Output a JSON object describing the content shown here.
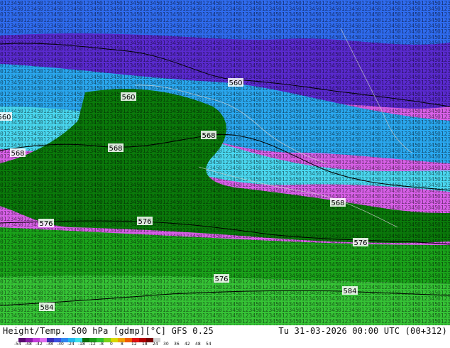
{
  "title": {
    "product": "Height/Temp. 500 hPa [gdmp][°C] GFS 0.25",
    "valid": "Tu 31-03-2026 00:00 UTC (00+312)"
  },
  "contour_labels": [
    "560",
    "560",
    "560",
    "568",
    "568",
    "568",
    "568",
    "576",
    "576",
    "576",
    "576",
    "584",
    "584"
  ],
  "colorbar": {
    "ticks": [
      "-54",
      "-48",
      "-42",
      "-38",
      "-30",
      "-24",
      "-18",
      "-12",
      "-8",
      "0",
      "8",
      "12",
      "18",
      "24",
      "30",
      "36",
      "42",
      "48",
      "54"
    ],
    "colors": [
      "#5a0a70",
      "#8a1aa8",
      "#c23cd8",
      "#e070f0",
      "#3a2ab8",
      "#3a50e0",
      "#2f86f0",
      "#22b8f0",
      "#3de0e8",
      "#0a6e0a",
      "#1a9a1a",
      "#2ec22e",
      "#7ad21a",
      "#d8d800",
      "#f0a000",
      "#f05a00",
      "#e01010",
      "#b00000",
      "#780000",
      "#d0d0d0"
    ]
  },
  "temperature_zones": [
    {
      "name": "magenta",
      "color": "#d860e8"
    },
    {
      "name": "violet",
      "color": "#5a2ad0"
    },
    {
      "name": "blue",
      "color": "#2f6cf0"
    },
    {
      "name": "light-blue",
      "color": "#2aa8f0"
    },
    {
      "name": "cyan",
      "color": "#4ad8f0"
    },
    {
      "name": "dark-green",
      "color": "#0a7a0a"
    },
    {
      "name": "green",
      "color": "#1aa41a"
    },
    {
      "name": "bright-green",
      "color": "#36c436"
    }
  ]
}
